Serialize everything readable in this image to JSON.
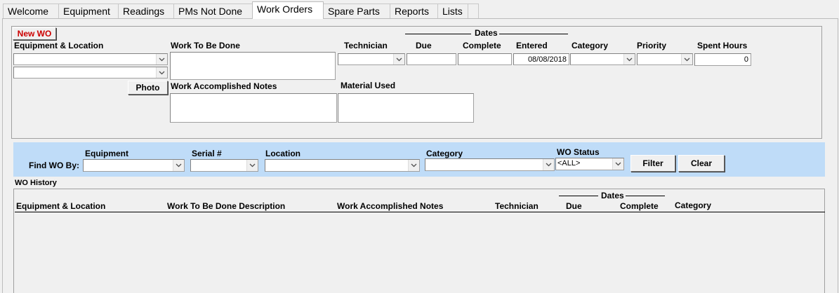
{
  "tabs": [
    {
      "label": "Welcome",
      "active": false
    },
    {
      "label": "Equipment",
      "active": false
    },
    {
      "label": "Readings",
      "active": false
    },
    {
      "label": "PMs Not Done",
      "active": false
    },
    {
      "label": "Work Orders",
      "active": true
    },
    {
      "label": "Spare Parts",
      "active": false
    },
    {
      "label": "Reports",
      "active": false
    },
    {
      "label": "Lists",
      "active": false
    }
  ],
  "form": {
    "new_wo_label": "New WO",
    "equipment_location_label": "Equipment & Location",
    "work_to_be_done_label": "Work To Be Done",
    "dates_label": "Dates",
    "technician_label": "Technician",
    "due_label": "Due",
    "complete_label": "Complete",
    "entered_label": "Entered",
    "category_label": "Category",
    "priority_label": "Priority",
    "spent_hours_label": "Spent Hours",
    "entered_value": "08/08/2018",
    "spent_hours_value": "0",
    "photo_label": "Photo",
    "work_accomplished_notes_label": "Work Accomplished Notes",
    "material_used_label": "Material Used"
  },
  "filter": {
    "find_wo_by_label": "Find WO By:",
    "equipment_label": "Equipment",
    "serial_label": "Serial #",
    "location_label": "Location",
    "category_label": "Category",
    "wo_status_label": "WO Status",
    "wo_status_value": "<ALL>",
    "filter_button": "Filter",
    "clear_button": "Clear"
  },
  "history": {
    "title": "WO History",
    "dates_label": "Dates",
    "columns": {
      "equipment_location": "Equipment & Location",
      "work_description": "Work To Be Done Description",
      "work_notes": "Work Accomplished Notes",
      "technician": "Technician",
      "due": "Due",
      "complete": "Complete",
      "category": "Category"
    },
    "rows": []
  },
  "colors": {
    "filter_bar_bg": "#bfdcf8",
    "new_wo_text": "#cc0000",
    "window_bg": "#f0f0f0"
  }
}
